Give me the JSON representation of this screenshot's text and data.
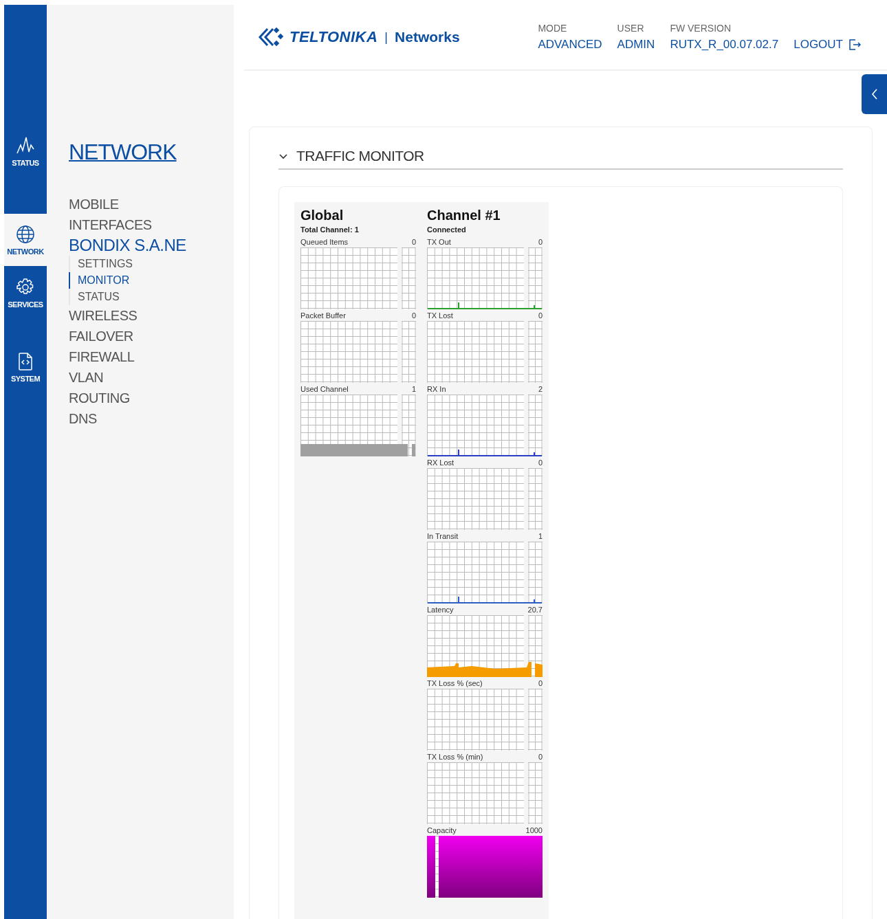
{
  "rail": [
    {
      "label": "STATUS",
      "selected": false
    },
    {
      "label": "NETWORK",
      "selected": true
    },
    {
      "label": "SERVICES",
      "selected": false
    },
    {
      "label": "SYSTEM",
      "selected": false
    }
  ],
  "sidebar": {
    "title": "NETWORK",
    "items": [
      {
        "label": "MOBILE",
        "selected": false
      },
      {
        "label": "INTERFACES",
        "selected": false
      },
      {
        "label": "BONDIX S.A.NE",
        "selected": true,
        "expanded": true,
        "children": [
          {
            "label": "SETTINGS",
            "selected": false
          },
          {
            "label": "MONITOR",
            "selected": true
          },
          {
            "label": "STATUS",
            "selected": false
          }
        ]
      },
      {
        "label": "WIRELESS",
        "selected": false
      },
      {
        "label": "FAILOVER",
        "selected": false
      },
      {
        "label": "FIREWALL",
        "selected": false
      },
      {
        "label": "VLAN",
        "selected": false
      },
      {
        "label": "ROUTING",
        "selected": false
      },
      {
        "label": "DNS",
        "selected": false
      }
    ]
  },
  "header": {
    "logo": {
      "brand": "TELTONIKA",
      "separator": "|",
      "product": "Networks"
    },
    "info": [
      {
        "label": "MODE",
        "value": "ADVANCED"
      },
      {
        "label": "USER",
        "value": "ADMIN"
      },
      {
        "label": "FW VERSION",
        "value": "RUTX_R_00.07.02.7"
      }
    ],
    "logout": "LOGOUT"
  },
  "section": {
    "title": "TRAFFIC MONITOR",
    "expanded": true
  },
  "monitor": [
    {
      "title": "Global",
      "subtitle": "Total Channel: 1",
      "graphs": [
        {
          "label": "Queued Items",
          "value": "0",
          "kind": "empty"
        },
        {
          "label": "Packet Buffer",
          "value": "0",
          "kind": "empty"
        },
        {
          "label": "Used Channel",
          "value": "1",
          "kind": "band",
          "color": "#a0a0a0"
        }
      ]
    },
    {
      "title": "Channel #1",
      "subtitle": "Connected",
      "graphs": [
        {
          "label": "TX Out",
          "value": "0",
          "kind": "dots",
          "color": "#2ca02c"
        },
        {
          "label": "TX Lost",
          "value": "0",
          "kind": "empty"
        },
        {
          "label": "RX In",
          "value": "2",
          "kind": "dots",
          "color": "#2b3fc4"
        },
        {
          "label": "RX Lost",
          "value": "0",
          "kind": "empty"
        },
        {
          "label": "In Transit",
          "value": "1",
          "kind": "dots",
          "color": "#2b5fc4"
        },
        {
          "label": "Latency",
          "value": "20.7",
          "kind": "area",
          "color": "#f59c00"
        },
        {
          "label": "TX Loss % (sec)",
          "value": "0",
          "kind": "empty"
        },
        {
          "label": "TX Loss % (min)",
          "value": "0",
          "kind": "empty"
        },
        {
          "label": "Capacity",
          "value": "1000",
          "kind": "gradient",
          "color": "#f000f0"
        }
      ]
    }
  ]
}
